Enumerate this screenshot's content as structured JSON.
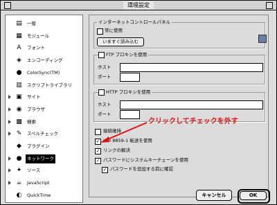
{
  "window": {
    "title": "環境設定"
  },
  "sidebar": {
    "items": [
      {
        "label": "一般",
        "icon": "general-icon",
        "glyph": "▤",
        "expand": false,
        "selected": false
      },
      {
        "label": "モジュール",
        "icon": "module-icon",
        "glyph": "▦",
        "expand": false,
        "selected": false
      },
      {
        "label": "フォント",
        "icon": "font-icon",
        "glyph": "A",
        "expand": false,
        "selected": false
      },
      {
        "label": "エンコーディング",
        "icon": "encoding-icon",
        "glyph": "◈",
        "expand": false,
        "selected": false
      },
      {
        "label": "ColorSync(TM)",
        "icon": "colorsync-icon",
        "glyph": "●",
        "expand": false,
        "selected": false
      },
      {
        "label": "スクリプトライブラリ",
        "icon": "script-library-icon",
        "glyph": "▥",
        "expand": false,
        "selected": false
      },
      {
        "label": "サイト",
        "icon": "site-icon",
        "glyph": "▣",
        "expand": true,
        "selected": false
      },
      {
        "label": "ブラウザ",
        "icon": "browser-icon",
        "glyph": "◉",
        "expand": true,
        "selected": false
      },
      {
        "label": "検索",
        "icon": "search-icon",
        "glyph": "▩",
        "expand": true,
        "selected": false
      },
      {
        "label": "スペルチェック",
        "icon": "spellcheck-icon",
        "glyph": "✎",
        "expand": true,
        "selected": false
      },
      {
        "label": "プラグイン",
        "icon": "plugin-icon",
        "glyph": "◆",
        "expand": false,
        "selected": false
      },
      {
        "label": "ネットワーク",
        "icon": "network-icon",
        "glyph": "●",
        "expand": true,
        "selected": true
      },
      {
        "label": "ソース",
        "icon": "source-icon",
        "glyph": "✦",
        "expand": true,
        "selected": false
      },
      {
        "label": "JavaScript",
        "icon": "javascript-icon",
        "glyph": "☕",
        "expand": true,
        "selected": false
      },
      {
        "label": "QuickTime",
        "icon": "quicktime-icon",
        "glyph": "◐",
        "expand": false,
        "selected": false
      }
    ]
  },
  "panel": {
    "internet_control": {
      "title": "インターネットコントロールパネル",
      "always_use": "常に使用",
      "always_use_checked": false,
      "load_now_button": "いますぐ読み込む"
    },
    "ftp": {
      "checkbox_label": "FTP プロキシを使用",
      "checked": false,
      "host_label": "ホスト",
      "port_label": "ポート",
      "host_value": "",
      "port_value": ""
    },
    "http": {
      "checkbox_label": "HTTP プロキシを使用",
      "checked": false,
      "host_label": "ホスト",
      "port_label": "ポート",
      "host_value": "",
      "port_value": ""
    },
    "options": [
      {
        "label": "接続維持",
        "checked": false
      },
      {
        "label": "ISO 8859-1 転送を使用",
        "checked": true
      },
      {
        "label": "リンクの解決",
        "checked": true
      },
      {
        "label": "パスワードにシステムキーチェーンを使用",
        "checked": true
      }
    ],
    "sub_option": {
      "label": "パスワードを追加する前に確認",
      "checked": true
    }
  },
  "buttons": {
    "cancel": "キャンセル",
    "ok": "OK"
  },
  "annotation": {
    "text": "クリックしてチェックを外す",
    "color": "#e01010"
  }
}
